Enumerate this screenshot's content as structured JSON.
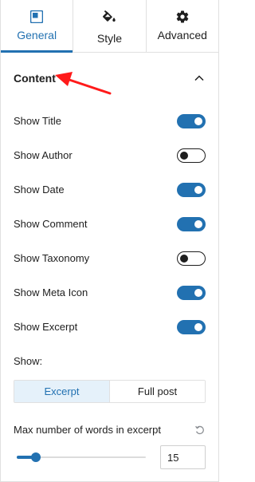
{
  "tabs": [
    {
      "label": "General",
      "icon": "layout-icon",
      "active": true
    },
    {
      "label": "Style",
      "icon": "paint-bucket-icon",
      "active": false
    },
    {
      "label": "Advanced",
      "icon": "gear-icon",
      "active": false
    }
  ],
  "section": {
    "title": "Content",
    "expanded": true
  },
  "toggles": [
    {
      "label": "Show Title",
      "on": true
    },
    {
      "label": "Show Author",
      "on": false
    },
    {
      "label": "Show Date",
      "on": true
    },
    {
      "label": "Show Comment",
      "on": true
    },
    {
      "label": "Show Taxonomy",
      "on": false
    },
    {
      "label": "Show Meta Icon",
      "on": true
    },
    {
      "label": "Show Excerpt",
      "on": true
    }
  ],
  "show": {
    "label": "Show:",
    "options": [
      "Excerpt",
      "Full post"
    ],
    "selected": "Excerpt"
  },
  "excerpt_words": {
    "label": "Max number of words in excerpt",
    "value": "15",
    "slider_fraction": 0.15
  },
  "colors": {
    "accent": "#2271b1",
    "selected_bg": "#e5f1fa",
    "annotation_arrow": "#ff0000"
  }
}
